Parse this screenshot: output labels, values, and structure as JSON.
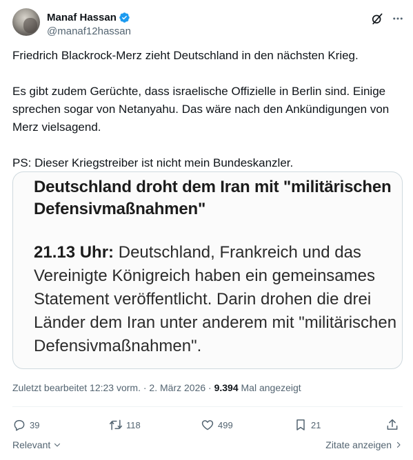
{
  "author": {
    "display_name": "Manaf Hassan",
    "handle": "@manaf12hassan"
  },
  "tweet": {
    "paragraphs": [
      "Friedrich Blackrock-Merz zieht Deutschland in den nächsten Krieg.",
      "Es gibt zudem Gerüchte, dass israelische Offizielle in Berlin sind. Einige sprechen sogar von Netanyahu. Das wäre nach den Ankündigungen von Merz vielsagend.",
      "PS: Dieser Kriegstreiber ist nicht mein Bundeskanzler."
    ]
  },
  "media": {
    "headline": "Deutschland droht dem Iran mit \"militärischen Defensivmaßnahmen\"",
    "time_label": "21.13 Uhr:",
    "body": " Deutschland, Frankreich und das Vereinigte Königreich haben ein gemeinsames Statement veröffentlicht. Darin drohen die drei Länder dem Iran unter anderem mit \"militärischen Defensivmaßnahmen\"."
  },
  "meta": {
    "edited": "Zuletzt bearbeitet 12:23 vorm. · 2. März 2026 · ",
    "views_count": "9.394",
    "views_label": " Mal angezeigt"
  },
  "actions": {
    "replies": "39",
    "reposts": "118",
    "likes": "499",
    "bookmarks": "21"
  },
  "footer": {
    "sort_label": "Relevant",
    "quotes_label": "Zitate anzeigen"
  },
  "colors": {
    "verified": "#1d9bf0",
    "text": "#0f1419",
    "secondary": "#536471",
    "border": "#cfd9de"
  },
  "icons": [
    "grok-icon",
    "more-icon",
    "verified-icon",
    "reply-icon",
    "repost-icon",
    "like-icon",
    "bookmark-icon",
    "share-icon",
    "chevron-down-icon",
    "chevron-right-icon"
  ]
}
